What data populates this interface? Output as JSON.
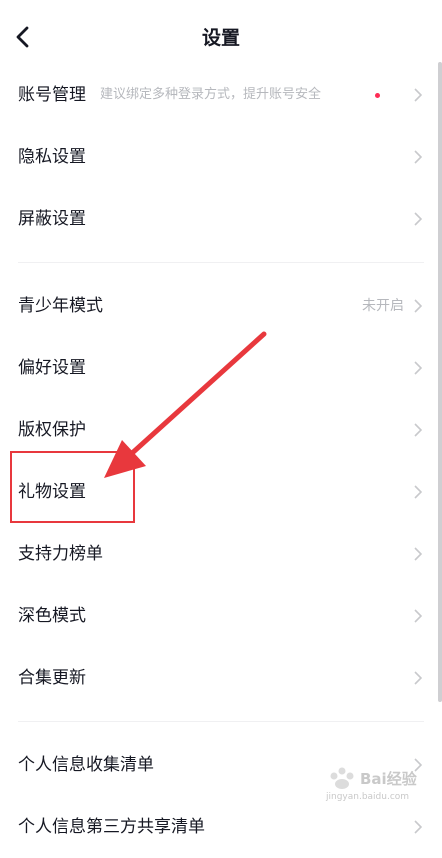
{
  "header": {
    "title": "设置"
  },
  "groups": [
    {
      "items": [
        {
          "label": "账号管理",
          "hint": "建议绑定多种登录方式，提升账号安全",
          "has_dot": true
        },
        {
          "label": "隐私设置"
        },
        {
          "label": "屏蔽设置"
        }
      ]
    },
    {
      "items": [
        {
          "label": "青少年模式",
          "status": "未开启"
        },
        {
          "label": "偏好设置"
        },
        {
          "label": "版权保护"
        },
        {
          "label": "礼物设置"
        },
        {
          "label": "支持力榜单"
        },
        {
          "label": "深色模式"
        },
        {
          "label": "合集更新"
        }
      ]
    },
    {
      "items": [
        {
          "label": "个人信息收集清单"
        },
        {
          "label": "个人信息第三方共享清单"
        }
      ]
    }
  ],
  "colors": {
    "accent_dot": "#fe2c55",
    "annotation": "#e8383d",
    "muted_text": "#b6b8bd"
  },
  "watermark": {
    "text": "Bai经验",
    "url": "jingyan.baidu.com"
  }
}
